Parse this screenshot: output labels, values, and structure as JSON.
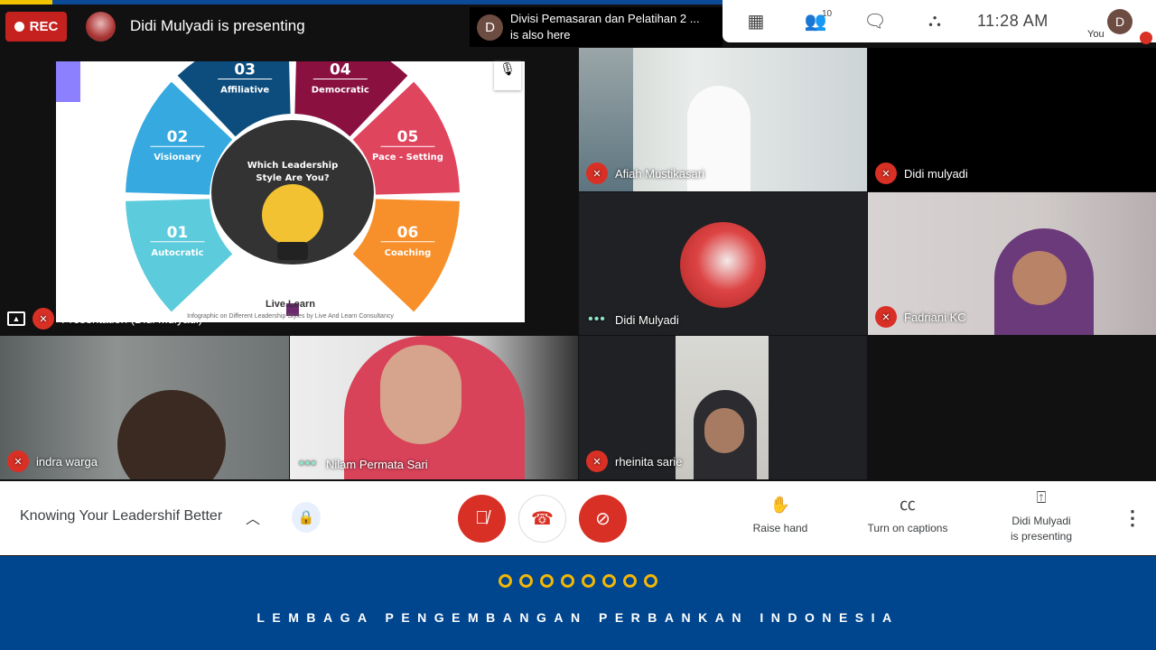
{
  "header": {
    "rec_label": "REC",
    "presenting_text": "Didi Mulyadi is presenting",
    "also_here": {
      "avatar_letter": "D",
      "line1": "Divisi Pemasaran dan Pelatihan 2 ...",
      "line2": "is also here"
    },
    "people_count": "10",
    "clock": "11:28 AM",
    "you_label": "You",
    "you_avatar": "D",
    "icons": [
      "grid-icon",
      "people-icon",
      "chat-icon",
      "activities-icon"
    ]
  },
  "presentation": {
    "tile_label": "Presentation (Didi Mulyadi)",
    "slide": {
      "center_text_1": "Which Leadership",
      "center_text_2": "Style Are You?",
      "segments": [
        {
          "num": "01",
          "label": "Autocratic",
          "color": "#5ccbdc"
        },
        {
          "num": "02",
          "label": "Visionary",
          "color": "#35a9e0"
        },
        {
          "num": "03",
          "label": "Affiliative",
          "color": "#0d4d7e"
        },
        {
          "num": "04",
          "label": "Democratic",
          "color": "#8a1040"
        },
        {
          "num": "05",
          "label": "Pace - Setting",
          "color": "#e0455e"
        },
        {
          "num": "06",
          "label": "Coaching",
          "color": "#f7902a"
        }
      ],
      "logo": "Live.Learn",
      "caption": "Infographic on Different Leadership Styles by Live And Learn Consultancy"
    }
  },
  "participants": [
    {
      "name": "Afiah Mustikasari",
      "muted": true
    },
    {
      "name": "Didi mulyadi",
      "muted": true
    },
    {
      "name": "Didi Mulyadi",
      "muted": false
    },
    {
      "name": "Fadriani KC",
      "muted": true
    },
    {
      "name": "indra warga",
      "muted": true
    },
    {
      "name": "Nilam Permata Sari",
      "muted": false
    },
    {
      "name": "rheinita sarie",
      "muted": true
    }
  ],
  "controls": {
    "meeting_title": "Knowing Your Leadershif Better",
    "raise_hand": "Raise hand",
    "captions": "Turn on captions",
    "presenting_1": "Didi Mulyadi",
    "presenting_2": "is presenting"
  },
  "footer": {
    "org": "LEMBAGA PENGEMBANGAN PERBANKAN INDONESIA",
    "ring_color": "#f2b705",
    "bg": "#00468f"
  }
}
